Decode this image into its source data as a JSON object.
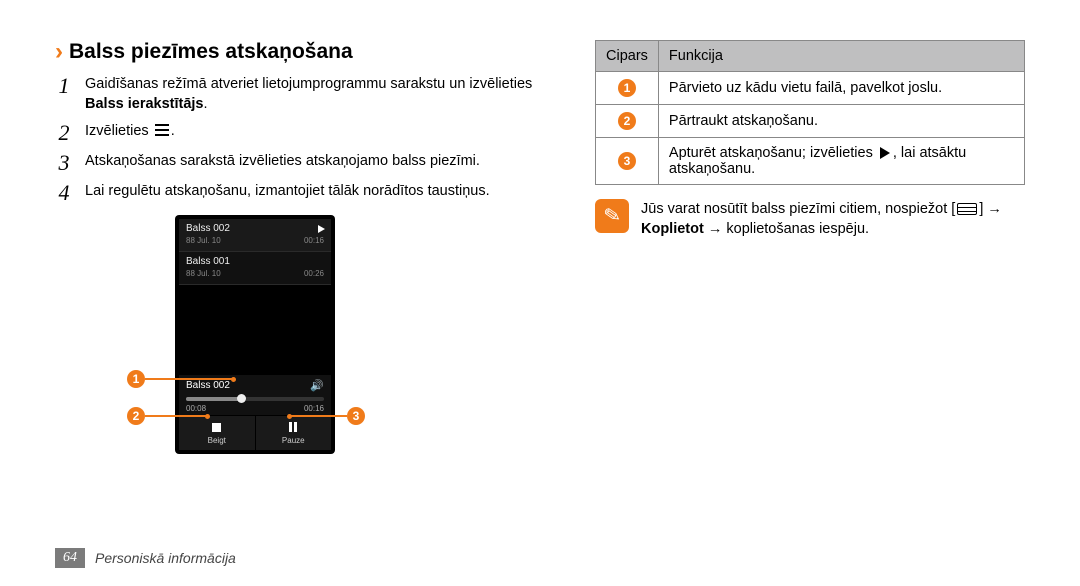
{
  "heading": "Balss piezīmes atskaņošana",
  "steps": [
    {
      "n": "1",
      "html": "Gaidīšanas režīmā atveriet lietojumprogrammu sarakstu un izvēlieties <b>Balss ierakstītājs</b>."
    },
    {
      "n": "2",
      "html": "Izvēlieties <span class='list-icon'></span>."
    },
    {
      "n": "3",
      "html": "Atskaņošanas sarakstā izvēlieties atskaņojamo balss piezīmi."
    },
    {
      "n": "4",
      "html": "Lai regulētu atskaņošanu, izmantojiet tālāk norādītos taustiņus."
    }
  ],
  "phone": {
    "items": [
      {
        "title": "Balss  002",
        "date": "88 Jul. 10",
        "dur": "00:16",
        "play": true
      },
      {
        "title": "Balss  001",
        "date": "88 Jul. 10",
        "dur": "00:26",
        "play": false
      }
    ],
    "now": {
      "title": "Balss  002",
      "t1": "00:08",
      "t2": "00:16"
    },
    "btn_stop": "Beigt",
    "btn_pause": "Pauze"
  },
  "table": {
    "h1": "Cipars",
    "h2": "Funkcija",
    "rows": [
      {
        "n": "1",
        "text": "Pārvieto uz kādu vietu failā, pavelkot joslu."
      },
      {
        "n": "2",
        "text": "Pārtraukt atskaņošanu."
      },
      {
        "n": "3",
        "html": "Apturēt atskaņošanu; izvēlieties <span class='play-inline'></span>, lai atsāktu atskaņošanu."
      }
    ]
  },
  "tip": {
    "html": "Jūs varat nosūtīt balss piezīmi citiem, nospiežot [<span class='menu-inline'></span>] → <b>Koplietot</b> → koplietošanas iespēju."
  },
  "footer": {
    "page": "64",
    "section": "Personiskā informācija"
  }
}
